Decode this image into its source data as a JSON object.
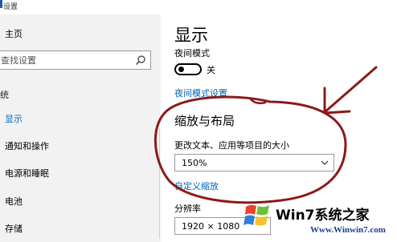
{
  "window": {
    "title": "设置"
  },
  "sidebar": {
    "home": "主页",
    "search_placeholder": "查找设置",
    "section_label": "统",
    "items": [
      {
        "label": "显示",
        "active": true
      },
      {
        "label": "通知和操作"
      },
      {
        "label": "电源和睡眠"
      },
      {
        "label": "电池"
      },
      {
        "label": "存储"
      }
    ]
  },
  "main": {
    "page_title": "显示",
    "night_mode_label": "夜间模式",
    "night_mode_state": "关",
    "night_mode_link": "夜间模式设置",
    "scale_section_title": "缩放与布局",
    "size_label": "更改文本、应用等项目的大小",
    "size_value": "150%",
    "custom_scaling_link": "自定义缩放",
    "resolution_label": "分辨率",
    "resolution_value": "1920 × 1080"
  },
  "watermark": {
    "text": "Win7系统之家",
    "url": "Www.Winwin7.com"
  },
  "colors": {
    "accent": "#0063b1",
    "annotation": "#8b1a1a",
    "sidebar_bg": "#f2f2f2"
  },
  "icons": {
    "search": "search-icon",
    "chevron": "chevron-down-icon",
    "logo": "windows-logo-icon"
  }
}
